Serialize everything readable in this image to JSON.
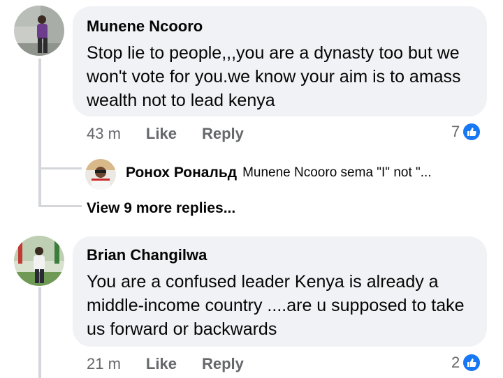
{
  "comments": [
    {
      "author": "Munene Ncooro",
      "text": "Stop lie to people,,,you are a dynasty too but we won't vote for you.we know your aim is to amass wealth not to lead kenya",
      "time": "43 m",
      "like_label": "Like",
      "reply_label": "Reply",
      "reaction_count": "7",
      "reaction_icon": "like-icon",
      "reply_preview": {
        "author": "Ронох Рональд",
        "text": "Munene Ncooro sema \"I\" not \"...",
        "view_more": "View 9 more replies..."
      }
    },
    {
      "author": "Brian Changilwa",
      "text": "You are a confused leader Kenya is already a middle-income country ....are u supposed to take us forward or backwards",
      "time": "21 m",
      "like_label": "Like",
      "reply_label": "Reply",
      "reaction_count": "2",
      "reaction_icon": "like-icon"
    }
  ],
  "colors": {
    "bubble": "#f0f2f5",
    "meta_text": "#65676b",
    "like_blue": "#1877f2",
    "thread_line": "#d4d6da"
  }
}
